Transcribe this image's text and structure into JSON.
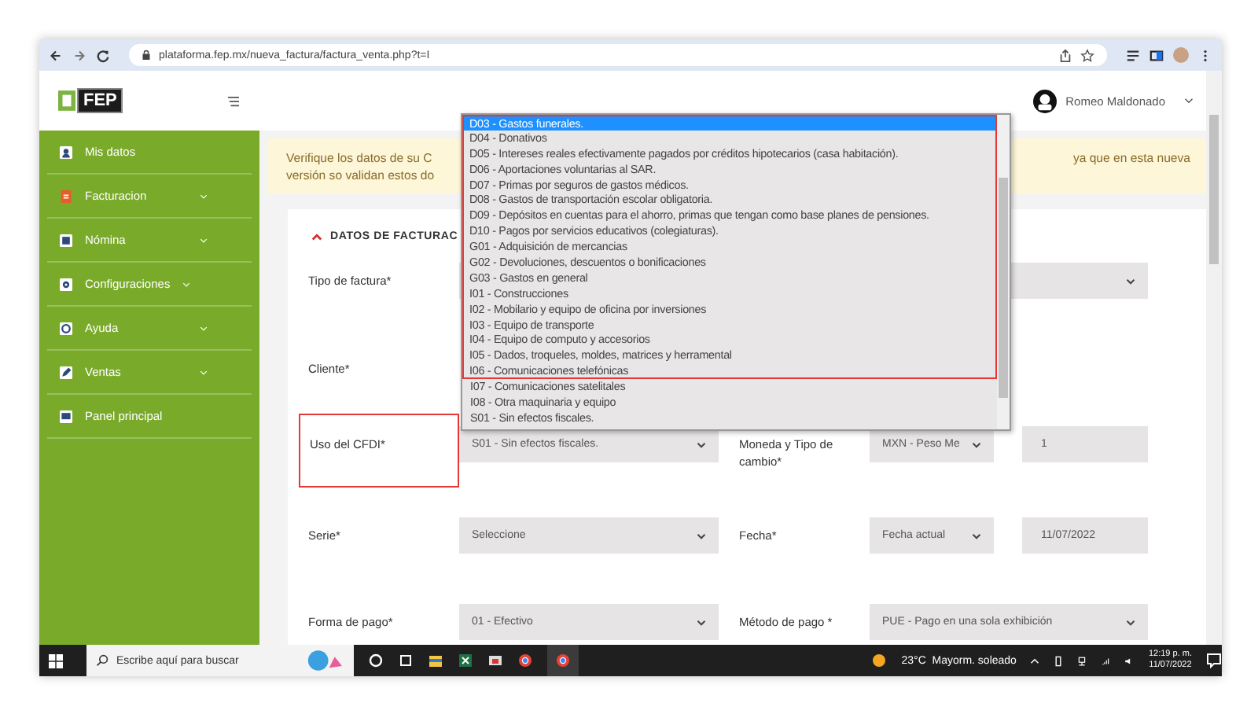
{
  "browser": {
    "url": "plataforma.fep.mx/nueva_factura/factura_venta.php?t=I"
  },
  "sidebar": {
    "logo": "FEP",
    "items": [
      {
        "label": "Mis datos",
        "has_submenu": false
      },
      {
        "label": "Facturacion",
        "has_submenu": true
      },
      {
        "label": "Nómina",
        "has_submenu": true
      },
      {
        "label": "Configuraciones",
        "has_submenu": true
      },
      {
        "label": "Ayuda",
        "has_submenu": true
      },
      {
        "label": "Ventas",
        "has_submenu": true
      },
      {
        "label": "Panel principal",
        "has_submenu": false
      }
    ]
  },
  "topbar": {
    "user": "Romeo Maldonado"
  },
  "alert": {
    "left_lines": [
      "Verifique los datos de su C",
      "versión so validan estos do"
    ],
    "right_text": "ya que en esta nueva"
  },
  "form": {
    "title": "DATOS DE FACTURAC",
    "rows": [
      {
        "label": "Tipo de factura*",
        "highlighted": false,
        "controls": [
          {
            "kind": "wide-select"
          }
        ]
      },
      {
        "label": "Cliente*",
        "highlighted": false,
        "controls": []
      },
      {
        "label": "Uso del CFDI*",
        "highlighted": true,
        "controls": [
          {
            "kind": "select",
            "value": "S01 - Sin efectos fiscales."
          }
        ],
        "right_label": "Moneda y Tipo de cambio*",
        "right_controls": [
          {
            "kind": "select",
            "value": "MXN - Peso Me"
          },
          {
            "kind": "input",
            "value": "1"
          }
        ]
      },
      {
        "label": "Serie*",
        "highlighted": false,
        "controls": [
          {
            "kind": "select",
            "value": "Seleccione"
          }
        ],
        "right_label": "Fecha*",
        "right_controls": [
          {
            "kind": "select",
            "value": "Fecha actual"
          },
          {
            "kind": "input",
            "value": "11/07/2022"
          }
        ]
      },
      {
        "label": "Forma de pago*",
        "highlighted": false,
        "controls": [
          {
            "kind": "select",
            "value": "01 - Efectivo"
          }
        ],
        "right_label": "Método de pago *",
        "right_controls": [
          {
            "kind": "wide-select",
            "value": "PUE - Pago en una sola exhibición"
          }
        ]
      }
    ]
  },
  "dropdown": {
    "options": [
      {
        "label": "D03 - Gastos funerales.",
        "selected": true,
        "highlighted": true
      },
      {
        "label": "D04 - Donativos",
        "selected": false,
        "highlighted": true
      },
      {
        "label": "D05 - Intereses reales efectivamente pagados por créditos hipotecarios (casa habitación).",
        "selected": false,
        "highlighted": true
      },
      {
        "label": "D06 - Aportaciones voluntarias al SAR.",
        "selected": false,
        "highlighted": true
      },
      {
        "label": "D07 - Primas por seguros de gastos médicos.",
        "selected": false,
        "highlighted": true
      },
      {
        "label": "D08 - Gastos de transportación escolar obligatoria.",
        "selected": false,
        "highlighted": true
      },
      {
        "label": "D09 - Depósitos en cuentas para el ahorro, primas que tengan como base planes de pensiones.",
        "selected": false,
        "highlighted": true
      },
      {
        "label": "D10 - Pagos por servicios educativos (colegiaturas).",
        "selected": false,
        "highlighted": true
      },
      {
        "label": "G01 - Adquisición de mercancias",
        "selected": false,
        "highlighted": true
      },
      {
        "label": "G02 - Devoluciones, descuentos o bonificaciones",
        "selected": false,
        "highlighted": true
      },
      {
        "label": "G03 - Gastos en general",
        "selected": false,
        "highlighted": true
      },
      {
        "label": "I01 - Construcciones",
        "selected": false,
        "highlighted": true
      },
      {
        "label": "I02 - Mobilario y equipo de oficina por inversiones",
        "selected": false,
        "highlighted": true
      },
      {
        "label": "I03 - Equipo de transporte",
        "selected": false,
        "highlighted": true
      },
      {
        "label": "I04 - Equipo de computo y accesorios",
        "selected": false,
        "highlighted": true
      },
      {
        "label": "I05 - Dados, troqueles, moldes, matrices y herramental",
        "selected": false,
        "highlighted": true
      },
      {
        "label": "I06 - Comunicaciones telefónicas",
        "selected": false,
        "highlighted": true
      },
      {
        "label": "I07 - Comunicaciones satelitales",
        "selected": false,
        "highlighted": false
      },
      {
        "label": "I08 - Otra maquinaria y equipo",
        "selected": false,
        "highlighted": false
      },
      {
        "label": "S01 - Sin efectos fiscales.",
        "selected": false,
        "highlighted": false
      }
    ]
  },
  "taskbar": {
    "search_placeholder": "Escribe aquí para buscar",
    "weather": "23°C  Mayorm. soleado",
    "time": "12:19 p. m.",
    "date": "11/07/2022"
  }
}
